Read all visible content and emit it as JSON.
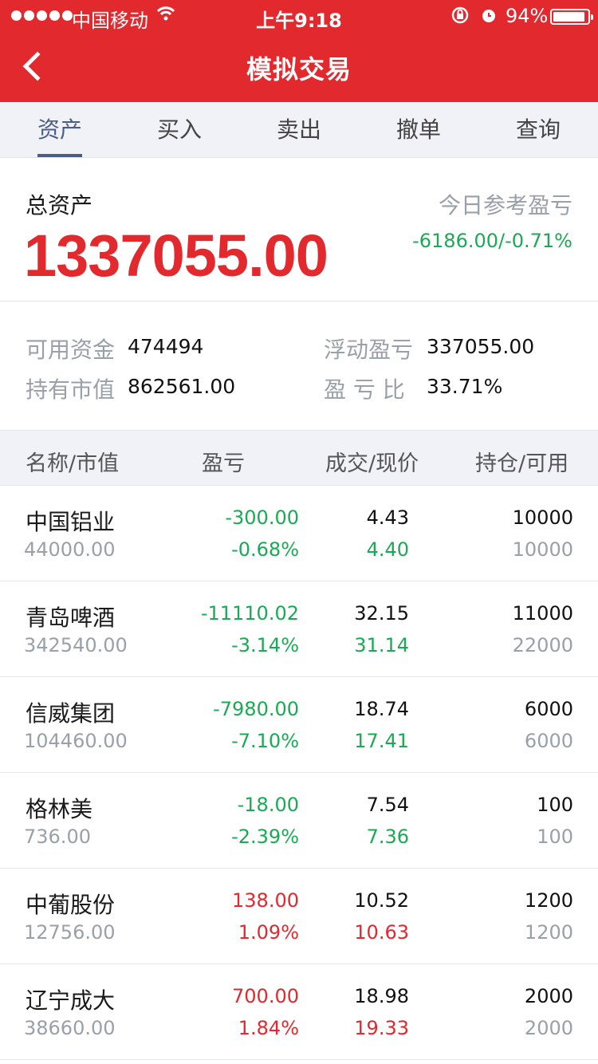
{
  "status": {
    "carrier": "中国移动",
    "time": "上午9:18",
    "battery": "94%",
    "battery_level": 0.94
  },
  "nav": {
    "title": "模拟交易"
  },
  "tabs": [
    {
      "label": "资产",
      "active": true
    },
    {
      "label": "买入",
      "active": false
    },
    {
      "label": "卖出",
      "active": false
    },
    {
      "label": "撤单",
      "active": false
    },
    {
      "label": "查询",
      "active": false
    }
  ],
  "summary": {
    "total_label": "总资产",
    "total_value": "1337055.00",
    "ref_label": "今日参考盈亏",
    "ref_value": "-6186.00/-0.71%"
  },
  "details": {
    "available_label": "可用资金",
    "available_value": "474494",
    "float_label": "浮动盈亏",
    "float_value": "337055.00",
    "market_label": "持有市值",
    "market_value": "862561.00",
    "ratio_label": "盈 亏 比",
    "ratio_value": "33.71%"
  },
  "table": {
    "headers": [
      "名称/市值",
      "盈亏",
      "成交/现价",
      "持仓/可用"
    ],
    "rows": [
      {
        "name": "中国铝业",
        "market_value": "44000.00",
        "pl": "-300.00",
        "pl_pct": "-0.68%",
        "deal": "4.43",
        "current": "4.40",
        "holding": "10000",
        "available": "10000",
        "trend": "down"
      },
      {
        "name": "青岛啤酒",
        "market_value": "342540.00",
        "pl": "-11110.02",
        "pl_pct": "-3.14%",
        "deal": "32.15",
        "current": "31.14",
        "holding": "11000",
        "available": "22000",
        "trend": "down"
      },
      {
        "name": "信威集团",
        "market_value": "104460.00",
        "pl": "-7980.00",
        "pl_pct": "-7.10%",
        "deal": "18.74",
        "current": "17.41",
        "holding": "6000",
        "available": "6000",
        "trend": "down"
      },
      {
        "name": "格林美",
        "market_value": "736.00",
        "pl": "-18.00",
        "pl_pct": "-2.39%",
        "deal": "7.54",
        "current": "7.36",
        "holding": "100",
        "available": "100",
        "trend": "down"
      },
      {
        "name": "中葡股份",
        "market_value": "12756.00",
        "pl": "138.00",
        "pl_pct": "1.09%",
        "deal": "10.52",
        "current": "10.63",
        "holding": "1200",
        "available": "1200",
        "trend": "up"
      },
      {
        "name": "辽宁成大",
        "market_value": "38660.00",
        "pl": "700.00",
        "pl_pct": "1.84%",
        "deal": "18.98",
        "current": "19.33",
        "holding": "2000",
        "available": "2000",
        "trend": "up"
      }
    ]
  },
  "colors": {
    "brand_red": "#e1292e",
    "gain": "#e1292e",
    "loss": "#1aaa55",
    "tab_active": "#4a5e85"
  }
}
